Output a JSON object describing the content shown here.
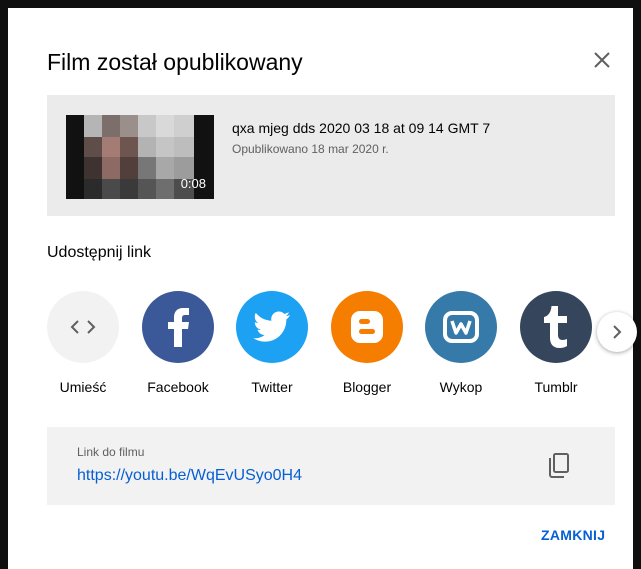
{
  "dialog": {
    "title": "Film został opublikowany",
    "close_icon": "close-icon"
  },
  "video": {
    "duration": "0:08",
    "title": "qxa mjeg dds 2020 03 18 at 09 14 GMT 7",
    "published": "Opublikowano 18 mar 2020 r."
  },
  "share": {
    "heading": "Udostępnij link",
    "items": [
      {
        "label": "Umieść",
        "icon": "embed-icon",
        "color": "#f2f2f2"
      },
      {
        "label": "Facebook",
        "icon": "facebook-icon",
        "color": "#3b5998"
      },
      {
        "label": "Twitter",
        "icon": "twitter-icon",
        "color": "#1da1f2"
      },
      {
        "label": "Blogger",
        "icon": "blogger-icon",
        "color": "#f57d00"
      },
      {
        "label": "Wykop",
        "icon": "wykop-icon",
        "color": "#367aa9"
      },
      {
        "label": "Tumblr",
        "icon": "tumblr-icon",
        "color": "#35465c"
      }
    ],
    "next_icon": "chevron-right-icon"
  },
  "link": {
    "label": "Link do filmu",
    "url": "https://youtu.be/WqEvUSyo0H4",
    "copy_icon": "copy-icon"
  },
  "footer": {
    "close_label": "ZAMKNIJ"
  },
  "colors": {
    "accent": "#065fd4",
    "card_bg": "#ebebeb"
  }
}
